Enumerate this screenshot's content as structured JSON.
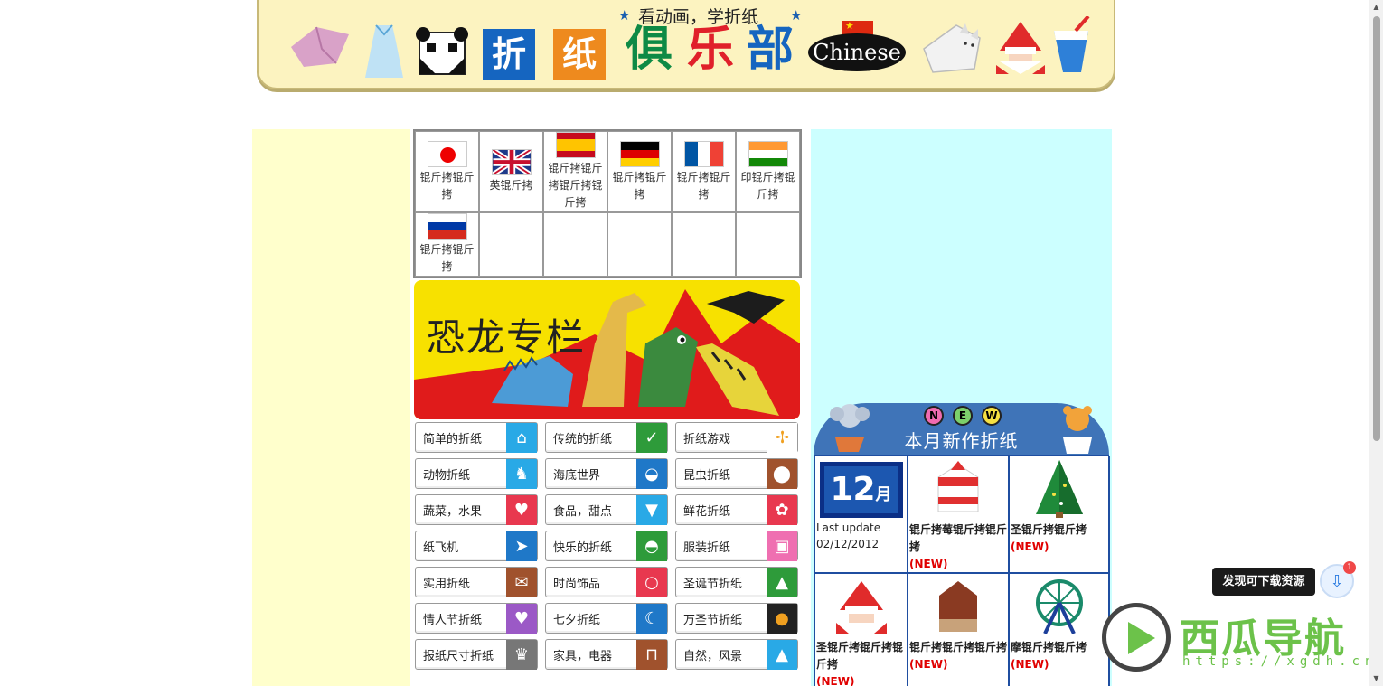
{
  "header": {
    "subtitle": "看动画，学折纸",
    "tile1": "折",
    "tile2": "纸",
    "title_chars": [
      "俱",
      "乐",
      "部"
    ],
    "language_badge": "Chinese"
  },
  "languages": [
    {
      "label": "锟斤拷锟斤拷",
      "flag": "jp"
    },
    {
      "label": "英锟斤拷",
      "flag": "uk"
    },
    {
      "label": "锟斤拷锟斤拷锟斤拷锟斤拷",
      "flag": "es"
    },
    {
      "label": "锟斤拷锟斤拷",
      "flag": "de"
    },
    {
      "label": "锟斤拷锟斤拷",
      "flag": "fr"
    },
    {
      "label": "印锟斤拷锟斤拷",
      "flag": "in"
    },
    {
      "label": "锟斤拷锟斤拷",
      "flag": "ru"
    }
  ],
  "dino_banner": {
    "title": "恐龙专栏"
  },
  "categories": [
    {
      "label": "简单的折纸",
      "color": "#29a9e6",
      "icon": "house-icon"
    },
    {
      "label": "传统的折纸",
      "color": "#2e9b3a",
      "icon": "crane-icon"
    },
    {
      "label": "折纸游戏",
      "color": "#ffffff",
      "icon": "pinwheel-icon"
    },
    {
      "label": "动物折纸",
      "color": "#29a9e6",
      "icon": "giraffe-icon"
    },
    {
      "label": "海底世界",
      "color": "#1f78c8",
      "icon": "fish-icon"
    },
    {
      "label": "昆虫折纸",
      "color": "#a0522d",
      "icon": "ladybug-icon"
    },
    {
      "label": "蔬菜，水果",
      "color": "#e8384f",
      "icon": "strawberry-icon"
    },
    {
      "label": "食品，甜点",
      "color": "#29a9e6",
      "icon": "icecream-icon"
    },
    {
      "label": "鲜花折纸",
      "color": "#e8384f",
      "icon": "flower-icon"
    },
    {
      "label": "纸飞机",
      "color": "#1f78c8",
      "icon": "airplane-icon"
    },
    {
      "label": "快乐的折纸",
      "color": "#2e9b3a",
      "icon": "hat-icon"
    },
    {
      "label": "服装折纸",
      "color": "#ef6fb1",
      "icon": "shirt-icon"
    },
    {
      "label": "实用折纸",
      "color": "#a0522d",
      "icon": "envelope-icon"
    },
    {
      "label": "时尚饰品",
      "color": "#e8384f",
      "icon": "necklace-icon"
    },
    {
      "label": "圣诞节折纸",
      "color": "#2e9b3a",
      "icon": "tree-icon"
    },
    {
      "label": "情人节折纸",
      "color": "#9b59c6",
      "icon": "heart-icon"
    },
    {
      "label": "七夕折纸",
      "color": "#1f78c8",
      "icon": "tanabata-icon"
    },
    {
      "label": "万圣节折纸",
      "color": "#222222",
      "icon": "pumpkin-icon"
    },
    {
      "label": "报纸尺寸折纸",
      "color": "#777777",
      "icon": "crown-icon"
    },
    {
      "label": "家具，电器",
      "color": "#a0522d",
      "icon": "table-icon"
    },
    {
      "label": "自然，风景",
      "color": "#29a9e6",
      "icon": "mountain-icon"
    }
  ],
  "new_works": {
    "title": "本月新作折纸",
    "badges": [
      "N",
      "E",
      "W"
    ],
    "month_number": "12",
    "month_suffix": "月",
    "last_update_label": "Last update",
    "last_update_date": "02/12/2012",
    "items": [
      {
        "name": "锟斤拷莓锟斤拷锟斤拷",
        "new": "(NEW)",
        "icon": "strawberry-cake-icon"
      },
      {
        "name": "圣锟斤拷锟斤拷",
        "new": "(NEW)",
        "icon": "christmas-tree-icon"
      },
      {
        "name": "圣锟斤拷锟斤拷锟斤拷",
        "new": "(NEW)",
        "icon": "santa-icon"
      },
      {
        "name": "锟斤拷锟斤拷锟斤拷",
        "new": "(NEW)",
        "icon": "chocolate-house-icon"
      },
      {
        "name": "摩锟斤拷锟斤拷",
        "new": "(NEW)",
        "icon": "ferris-wheel-icon"
      }
    ]
  },
  "overlay": {
    "download_text": "发现可下载资源",
    "download_count": "1",
    "watermark": "西瓜导航",
    "watermark_url": "https://xgdh.cn"
  }
}
